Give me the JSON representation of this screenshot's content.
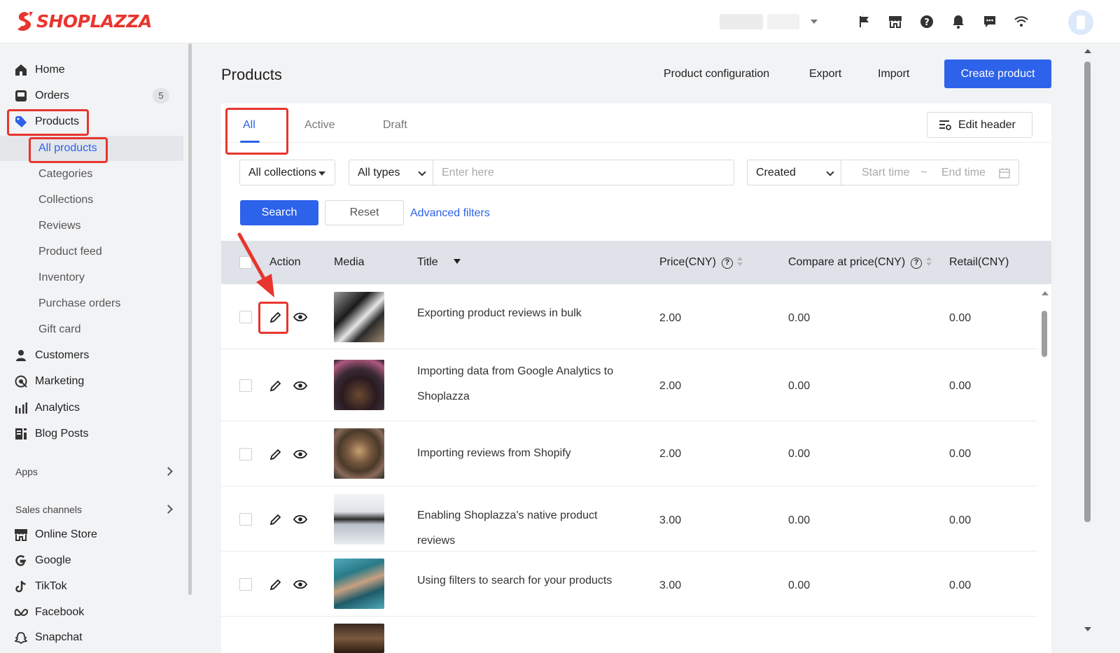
{
  "brand": {
    "name": "SHOPLAZZA",
    "color": "#e8352e",
    "accent": "#2d62ea"
  },
  "topbar": {
    "icons": [
      "flag-icon",
      "store-icon",
      "help-icon",
      "bell-icon",
      "message-icon",
      "wifi-icon"
    ]
  },
  "sidebar": {
    "items": [
      {
        "label": "Home",
        "icon": "home-icon"
      },
      {
        "label": "Orders",
        "icon": "orders-icon",
        "badge": "5"
      },
      {
        "label": "Products",
        "icon": "tag-icon"
      }
    ],
    "product_subitems": [
      "All products",
      "Categories",
      "Collections",
      "Reviews",
      "Product feed",
      "Inventory",
      "Purchase orders",
      "Gift card"
    ],
    "more_items": [
      {
        "label": "Customers",
        "icon": "person-icon"
      },
      {
        "label": "Marketing",
        "icon": "marketing-icon"
      },
      {
        "label": "Analytics",
        "icon": "analytics-icon"
      },
      {
        "label": "Blog Posts",
        "icon": "blog-icon"
      }
    ],
    "apps_label": "Apps",
    "sales_channels_label": "Sales channels",
    "channels": [
      {
        "label": "Online Store",
        "icon": "store-icon"
      },
      {
        "label": "Google",
        "icon": "google-icon"
      },
      {
        "label": "TikTok",
        "icon": "tiktok-icon"
      },
      {
        "label": "Facebook",
        "icon": "meta-icon"
      },
      {
        "label": "Snapchat",
        "icon": "snapchat-icon"
      }
    ]
  },
  "header": {
    "title": "Products",
    "product_configuration": "Product configuration",
    "export": "Export",
    "import": "Import",
    "create_product": "Create product"
  },
  "tabs": [
    "All",
    "Active",
    "Draft"
  ],
  "edit_header": "Edit header",
  "filters": {
    "collections": "All collections",
    "types": "All types",
    "search_placeholder": "Enter here",
    "date_field": "Created",
    "start_placeholder": "Start time",
    "range_sep": "~",
    "end_placeholder": "End time",
    "search_btn": "Search",
    "reset_btn": "Reset",
    "advanced": "Advanced filters"
  },
  "table": {
    "columns": {
      "action": "Action",
      "media": "Media",
      "title": "Title",
      "price": "Price(CNY)",
      "compare": "Compare at price(CNY)",
      "retail": "Retail(CNY)"
    },
    "rows": [
      {
        "title": "Exporting product reviews in bulk",
        "price": "2.00",
        "compare": "0.00",
        "retail": "0.00"
      },
      {
        "title": "Importing data from Google Analytics to Shoplazza",
        "price": "2.00",
        "compare": "0.00",
        "retail": "0.00"
      },
      {
        "title": "Importing reviews from Shopify",
        "price": "2.00",
        "compare": "0.00",
        "retail": "0.00"
      },
      {
        "title": "Enabling Shoplazza's native product reviews",
        "price": "3.00",
        "compare": "0.00",
        "retail": "0.00"
      },
      {
        "title": "Using filters to search for your products",
        "price": "3.00",
        "compare": "0.00",
        "retail": "0.00"
      }
    ]
  }
}
